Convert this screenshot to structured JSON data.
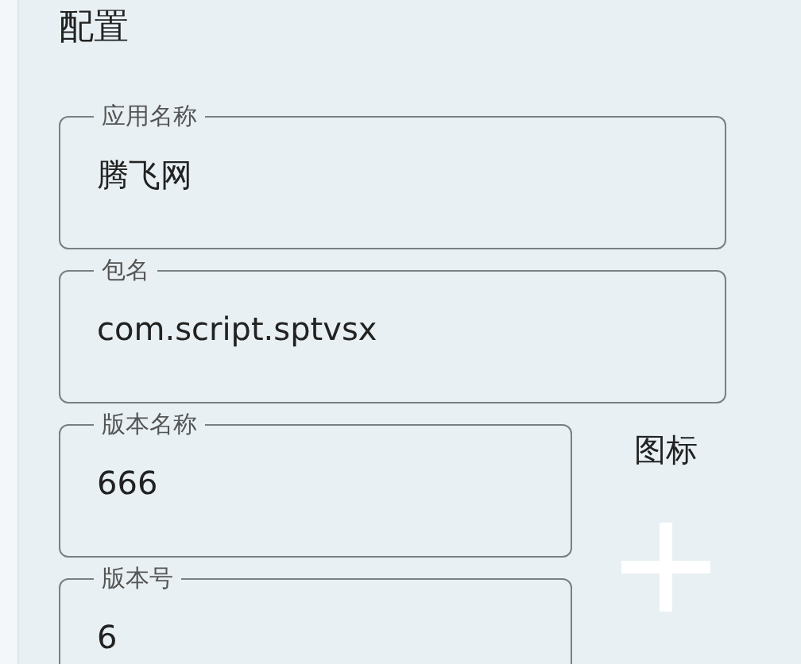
{
  "title": "配置",
  "fields": [
    {
      "label": "应用名称",
      "value": "腾飞网"
    },
    {
      "label": "包名",
      "value": "com.script.sptvsx"
    }
  ],
  "version_fields": [
    {
      "label": "版本名称",
      "value": "666"
    },
    {
      "label": "版本号",
      "value": "6"
    }
  ],
  "icon_section": {
    "label": "图标"
  }
}
